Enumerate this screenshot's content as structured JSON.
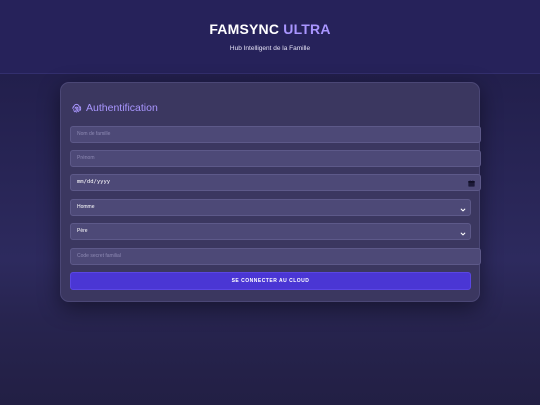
{
  "header": {
    "brand_main": "FAMSYNC",
    "brand_accent": "ULTRA",
    "subtitle": "Hub Intelligent de la Famille"
  },
  "auth": {
    "title": "Authentification",
    "fields": {
      "family_name_placeholder": "Nom de famille",
      "first_name_placeholder": "Prénom",
      "birthdate_value": "mm/dd/yyyy",
      "gender_value": "Homme",
      "role_value": "Père",
      "secret_code_placeholder": "Code secret familial"
    },
    "submit_label": "SE CONNECTER AU CLOUD"
  },
  "colors": {
    "accent": "#a996ff",
    "button": "#4a36d4",
    "header_bg": "#26225a",
    "card_bg": "#3b3760"
  },
  "icons": {
    "title_icon": "fingerprint-icon",
    "date_icon": "calendar-icon",
    "select_icon": "chevron-down-icon"
  }
}
